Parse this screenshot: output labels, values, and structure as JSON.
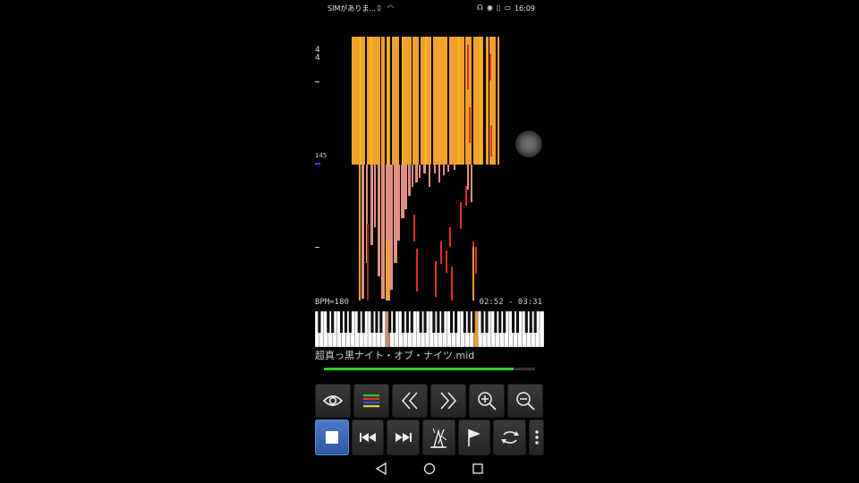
{
  "status_bar": {
    "carrier": "SIMがありま...",
    "time": "16:09",
    "icons": [
      "sim-icon",
      "wifi-icon",
      "headphones-icon",
      "eye-icon",
      "vibrate-icon",
      "battery-icon"
    ]
  },
  "roll": {
    "time_signature_top": "4",
    "time_signature_bottom": "4",
    "bpm_tick_label": "145",
    "colors": {
      "note_active": "#f0a030",
      "note_trail": "#e09080",
      "note_red": "#e03020",
      "bpm_marker": "#2a4cff"
    }
  },
  "info": {
    "bpm": "BPM=180",
    "time_range": "02:52 - 03:31"
  },
  "file": {
    "name": "超真っ黒ナイト・オブ・ナイツ.mid",
    "progress": 0.9
  },
  "toolbar_top": {
    "buttons": [
      "eye-icon",
      "tracks-icon",
      "rewind-page-icon",
      "forward-page-icon",
      "zoom-in-icon",
      "zoom-out-icon"
    ],
    "tracks_colors": [
      "#28c828",
      "#e03030",
      "#3050e0",
      "#e8d020"
    ]
  },
  "toolbar_bottom": {
    "buttons": [
      "stop-icon",
      "skip-back-icon",
      "skip-forward-icon",
      "metronome-icon",
      "flag-icon",
      "loop-icon",
      "more-icon"
    ],
    "stop_color": "#3a68b8"
  },
  "nav_bar": {
    "buttons": [
      "back-icon",
      "home-icon",
      "recents-icon"
    ]
  }
}
